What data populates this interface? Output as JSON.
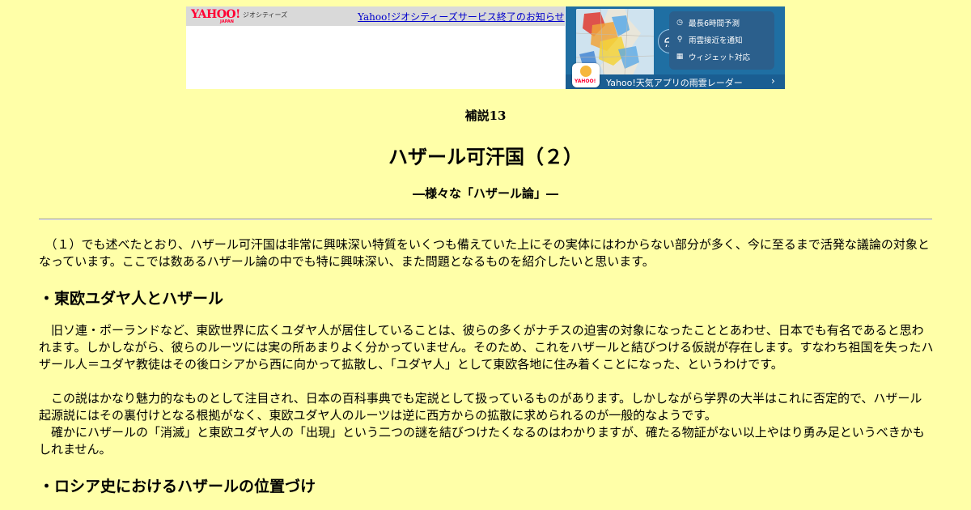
{
  "banner": {
    "yahoo_logo": "YAHOO!",
    "yahoo_logo_sub": "JAPAN",
    "geocities_label": "ジオシティーズ",
    "notice_link": "Yahoo!ジオシティーズサービス終了のお知らせ"
  },
  "ad": {
    "features": [
      "最長6時間予測",
      "雨雲接近を通知",
      "ウィジェット対応"
    ],
    "bottom_text": "Yahoo!天気アプリの雨雲レーダー",
    "arrow": "›",
    "app_icon_label": "YAHOO!"
  },
  "article": {
    "number": "補説13",
    "title": "ハザール可汗国（２）",
    "subtitle": "―様々な「ハザール論」―",
    "intro": "　（１）でも述べたとおり、ハザール可汗国は非常に興味深い特質をいくつも備えていた上にその実体にはわからない部分が多く、今に至るまで活発な議論の対象となっています。ここでは数あるハザール論の中でも特に興味深い、また問題となるものを紹介したいと思います。",
    "sections": [
      {
        "heading": "・東欧ユダヤ人とハザール",
        "paragraphs": [
          "　旧ソ連・ポーランドなど、東欧世界に広くユダヤ人が居住していることは、彼らの多くがナチスの迫害の対象になったこととあわせ、日本でも有名であると思われます。しかしながら、彼らのルーツには実の所あまりよく分かっていません。そのため、これをハザールと結びつける仮説が存在します。すなわち祖国を失ったハザール人＝ユダヤ教徒はその後ロシアから西に向かって拡散し、「ユダヤ人」として東欧各地に住み着くことになった、というわけです。",
          "　この説はかなり魅力的なものとして注目され、日本の百科事典でも定説として扱っているものがあります。しかしながら学界の大半はこれに否定的で、ハザール起源説にはその裏付けとなる根拠がなく、東欧ユダヤ人のルーツは逆に西方からの拡散に求められるのが一般的なようです。",
          "　確かにハザールの「消滅」と東欧ユダヤ人の「出現」という二つの謎を結びつけたくなるのはわかりますが、確たる物証がない以上やはり勇み足というべきかもしれません。"
        ]
      },
      {
        "heading": "・ロシア史におけるハザールの位置づけ",
        "paragraphs": []
      }
    ]
  }
}
